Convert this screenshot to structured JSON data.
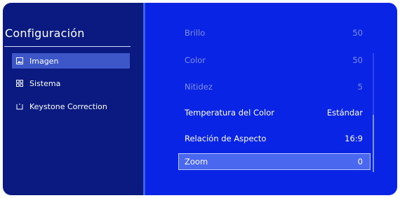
{
  "sidebar": {
    "title": "Configuración",
    "items": [
      {
        "label": "Imagen",
        "icon": "image-icon",
        "active": true
      },
      {
        "label": "Sistema",
        "icon": "grid-icon",
        "active": false
      },
      {
        "label": "Keystone Correction",
        "icon": "keystone-icon",
        "active": false
      }
    ]
  },
  "settings": {
    "items": [
      {
        "label": "Brillo",
        "value": "50",
        "state": "disabled"
      },
      {
        "label": "Color",
        "value": "50",
        "state": "disabled"
      },
      {
        "label": "Nitidez",
        "value": "5",
        "state": "disabled"
      },
      {
        "label": "Temperatura del Color",
        "value": "Estándar",
        "state": "normal"
      },
      {
        "label": "Relación de Aspecto",
        "value": "16:9",
        "state": "normal"
      },
      {
        "label": "Zoom",
        "value": "0",
        "state": "selected"
      }
    ]
  },
  "colors": {
    "sidebar_bg": "#0a1a80",
    "main_bg": "#0a24e6",
    "accent": "#3f63e8"
  }
}
